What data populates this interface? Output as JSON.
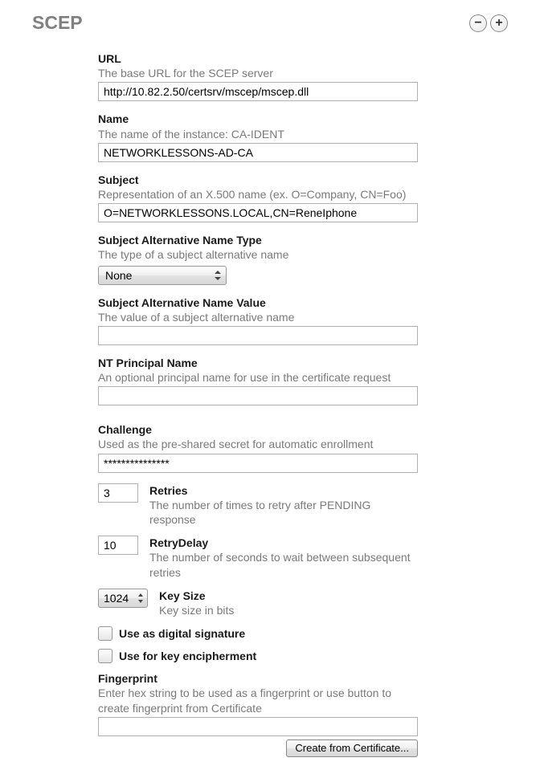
{
  "header": {
    "title": "SCEP",
    "minus": "−",
    "plus": "+"
  },
  "fields": {
    "url": {
      "label": "URL",
      "desc": "The base URL for the SCEP server",
      "value": "http://10.82.2.50/certsrv/mscep/mscep.dll"
    },
    "name": {
      "label": "Name",
      "desc": "The name of the instance: CA-IDENT",
      "value": "NETWORKLESSONS-AD-CA"
    },
    "subject": {
      "label": "Subject",
      "desc": "Representation of an X.500 name (ex. O=Company, CN=Foo)",
      "value": "O=NETWORKLESSONS.LOCAL,CN=ReneIphone"
    },
    "san_type": {
      "label": "Subject Alternative Name Type",
      "desc": "The type of a subject alternative name",
      "value": "None"
    },
    "san_value": {
      "label": "Subject Alternative Name Value",
      "desc": "The value of a subject alternative name",
      "value": ""
    },
    "nt_principal": {
      "label": "NT Principal Name",
      "desc": "An optional principal name for use in the certificate request",
      "value": ""
    },
    "challenge": {
      "label": "Challenge",
      "desc": "Used as the pre-shared secret for automatic enrollment",
      "value": "***************"
    },
    "retries": {
      "label": "Retries",
      "desc": "The number of times to retry after PENDING response",
      "value": "3"
    },
    "retry_delay": {
      "label": "RetryDelay",
      "desc": "The number of seconds to wait between subsequent retries",
      "value": "10"
    },
    "key_size": {
      "label": "Key Size",
      "desc": "Key size in bits",
      "value": "1024"
    },
    "digital_sig": {
      "label": "Use as digital signature"
    },
    "key_enciph": {
      "label": "Use for key encipherment"
    },
    "fingerprint": {
      "label": "Fingerprint",
      "desc": "Enter hex string to be used as a fingerprint or use button to create fingerprint from Certificate",
      "value": "",
      "button": "Create from Certificate..."
    }
  }
}
